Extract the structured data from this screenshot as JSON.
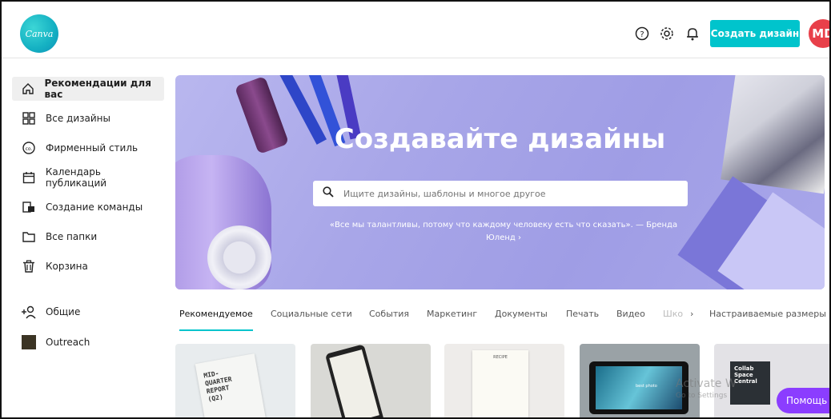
{
  "header": {
    "logo_text": "Canva",
    "help_icon": "help-circle-icon",
    "settings_icon": "gear-icon",
    "bell_icon": "bell-icon",
    "create_button": "Создать дизайн",
    "avatar_initials": "MD"
  },
  "sidebar": {
    "items": [
      {
        "label": "Рекомендации для вас",
        "icon": "home-icon",
        "active": true
      },
      {
        "label": "Все дизайны",
        "icon": "grid-icon"
      },
      {
        "label": "Фирменный стиль",
        "icon": "brand-kit-icon"
      },
      {
        "label": "Календарь публикаций",
        "icon": "calendar-icon"
      },
      {
        "label": "Создание команды",
        "icon": "team-icon"
      },
      {
        "label": "Все папки",
        "icon": "folder-icon"
      },
      {
        "label": "Корзина",
        "icon": "trash-icon"
      },
      {
        "label": "Общие",
        "icon": "add-people-icon"
      },
      {
        "label": "Outreach",
        "icon": "team-thumbnail"
      }
    ]
  },
  "hero": {
    "title": "Создавайте дизайны",
    "search_placeholder": "Ищите дизайны, шаблоны и многое другое",
    "quote_line1": "«Все мы талантливы, потому что каждому человеку есть что сказать». — Бренда",
    "quote_line2": "Юленд ›"
  },
  "tabs": [
    {
      "label": "Рекомендуемое",
      "active": true
    },
    {
      "label": "Социальные сети"
    },
    {
      "label": "События"
    },
    {
      "label": "Маркетинг"
    },
    {
      "label": "Документы"
    },
    {
      "label": "Печать"
    },
    {
      "label": "Видео"
    },
    {
      "label": "Шко"
    },
    {
      "label": "›"
    },
    {
      "label": "Настраиваемые размеры"
    }
  ],
  "cards": [
    {
      "text": "MID-\nQUARTER\nREPORT\n(Q2)"
    },
    {
      "text": ""
    },
    {
      "text": "RECIPE"
    },
    {
      "text": "best photo"
    },
    {
      "text": "Collab\nSpace\nCentral"
    }
  ],
  "overlay": {
    "activate_line1": "Activate W",
    "activate_line2": "Go to Settings",
    "help_button": "Помощь ?"
  }
}
